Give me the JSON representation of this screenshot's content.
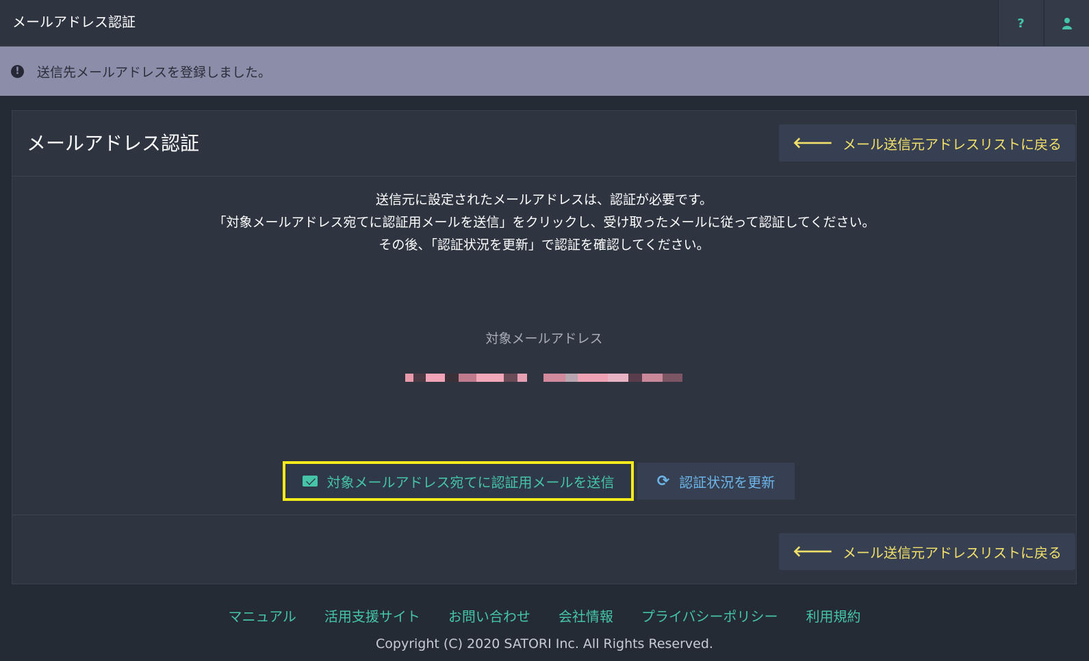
{
  "topbar": {
    "title": "メールアドレス認証",
    "help_icon": "question-icon",
    "user_icon": "user-icon"
  },
  "notice": {
    "icon": "exclamation-circle-icon",
    "text": "送信先メールアドレスを登録しました。"
  },
  "panel": {
    "title": "メールアドレス認証",
    "back_label": "メール送信元アドレスリストに戻る",
    "instructions": [
      "送信元に設定されたメールアドレスは、認証が必要です。",
      "「対象メールアドレス宛てに認証用メールを送信」をクリックし、受け取ったメールに従って認証してください。",
      "その後、「認証状況を更新」で認証を確認してください。"
    ],
    "target_label": "対象メールアドレス",
    "send_label": "対象メールアドレス宛てに認証用メールを送信",
    "refresh_label": "認証状況を更新"
  },
  "footer": {
    "links": [
      "マニュアル",
      "活用支援サイト",
      "お問い合わせ",
      "会社情報",
      "プライバシーポリシー",
      "利用規約"
    ],
    "copyright": "Copyright (C) 2020 SATORI Inc. All Rights Reserved."
  },
  "colors": {
    "accent_green": "#45c4a8",
    "accent_yellow": "#f3e06a",
    "highlight_yellow": "#f5ea1a",
    "link_blue": "#6db5e8"
  }
}
